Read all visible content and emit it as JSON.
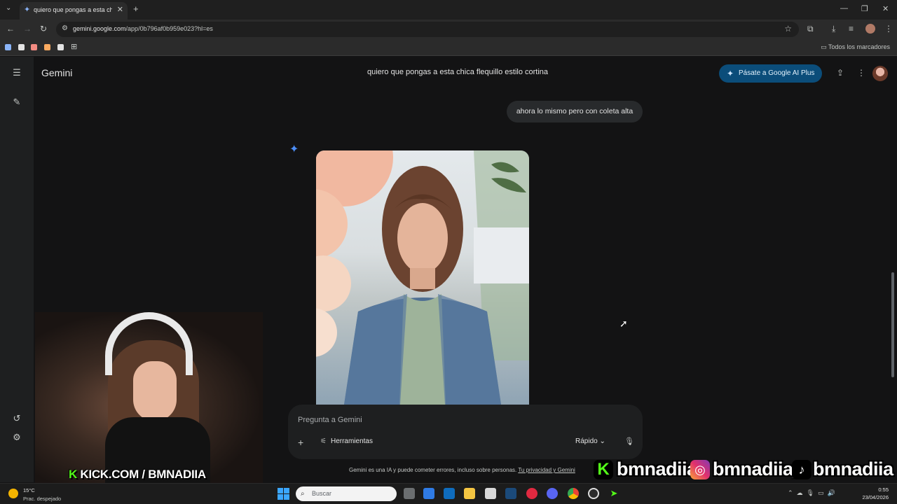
{
  "browser": {
    "tab_title": "quiero que pongas a esta chica flequillo estilo cortina",
    "tab_favicon": "gemini-spark-icon",
    "url_host": "gemini.google.com",
    "url_path": "/app/0b796af0b959e023?hl=es",
    "all_bookmarks_label": "Todos los marcadores"
  },
  "gemini": {
    "brand": "Gemini",
    "conversation_title": "quiero que pongas a esta chica flequillo estilo cortina",
    "upgrade_label": "Pásate a Google AI Plus",
    "user_message": "ahora lo mismo pero con coleta alta",
    "prompt_placeholder": "Pregunta a Gemini",
    "tools_label": "Herramientas",
    "mode_label": "Rápido",
    "disclaimer": "Gemini es una IA y puede cometer errores, incluso sobre personas.",
    "privacy_link": "Tu privacidad y Gemini",
    "accent_color": "#4c8df6",
    "upgrade_bg": "#0b4d7a"
  },
  "overlay": {
    "kick_prefix": "K",
    "kick_text": "KICK.COM / BMNADIIA",
    "social_kick": "bmnadiia",
    "social_instagram": "bmnadiia_",
    "social_tiktok": "bmnadiia",
    "kick_color": "#53fc18"
  },
  "taskbar": {
    "temperature": "15°C",
    "weather_desc": "Prac. despejado",
    "search_placeholder": "Buscar",
    "time": "0:55",
    "date": "23/04/2026"
  }
}
